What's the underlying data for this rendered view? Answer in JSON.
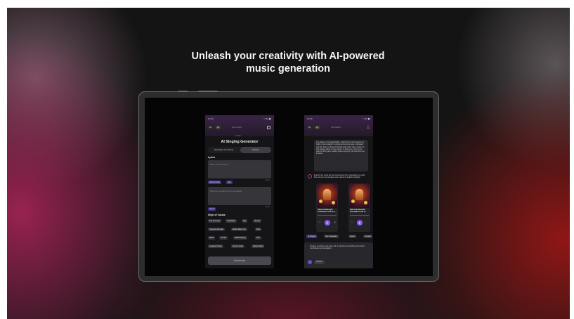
{
  "headline": "Unleash your creativity with AI-powered music generation",
  "phone1": {
    "time": "10:30",
    "signal": "∷ 5G ▮▮",
    "chip_left": "AL",
    "chip_credits": "23",
    "header_tab": "Start Project",
    "small_caption": "Create",
    "title": "AI Singing Generator",
    "tabs": [
      "Describe Your Song",
      "Custom"
    ],
    "lyrics_label": "Lyrics",
    "lyrics_placeholder": "Enter your own lyrics",
    "lyrics_count": "0/1000",
    "lyric_buttons": [
      "Help Me Write",
      "Vary"
    ],
    "prompt_placeholder": "What do you want lyrics to be about?",
    "prompt_count": "0/1000",
    "submit_label": "Submit",
    "style_label": "Style of Vocals",
    "style_tags": [
      [
        "Pop Chorused",
        "Pop Ballad",
        "Rap",
        "Hip-hop"
      ],
      [
        "Hyperpop Remade",
        "Mariah Maxm Cut",
        "Rock"
      ],
      [
        "Metal",
        "Acrobic",
        "ASMR Singing",
        "Duet"
      ],
      [
        "Gregorian Chant",
        "Ancient Chant",
        "Spoken Word"
      ]
    ],
    "generate_label": "Generate"
  },
  "phone2": {
    "time": "10:00",
    "signal": "∷ 5G ▮▮",
    "chip_left": "AL",
    "chip_credits": "23",
    "header_tab": "Start Ballad",
    "bubble_text": "In a garden of celestial delight, a fruit fell from the heavens so bright. A man caught it, consumed its divine taste, but beauty soon his heart embraced. Betraying the path, where desire so fruit divinity, above so they aspire. In their eyes, we're more grand to their gaze, leading power and glory, our lives they set to name.",
    "reply_text": "Extend Your audio file has transformed from imagination to reality. Dive into the soundscapes and explore its auditory delights!",
    "cards": [
      {
        "title": "Ethereal Betrayal: Forbidden Fruit of L..."
      },
      {
        "title": "Ethereal Betrayal: Forbidden Fruit of"
      }
    ],
    "tags": [
      "AI Singing",
      "Stem Separator",
      "Extend",
      "Autopilot"
    ],
    "input_text": "Produce a spoken word piece with a calming and soothing voice about mindfulness and meditation.",
    "custom_label": "Custom"
  },
  "colors": {
    "accent": "#8a5bf0",
    "pill_purple": "#44308a"
  }
}
